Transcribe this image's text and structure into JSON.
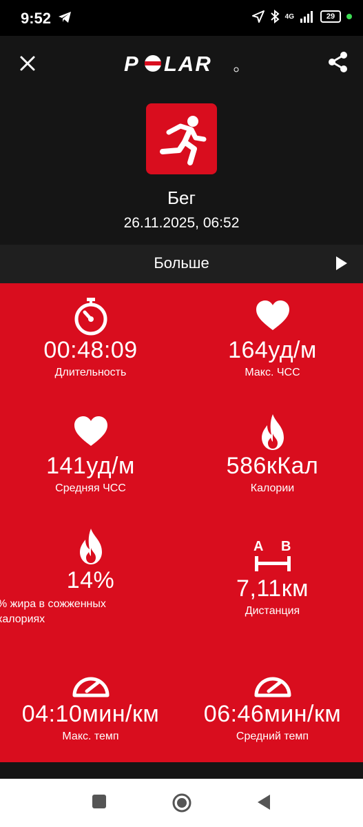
{
  "status_bar": {
    "time": "9:52",
    "battery": "29",
    "network": "4G"
  },
  "app_bar": {
    "brand": "POLAR",
    "close_icon": "close-icon",
    "share_icon": "share-icon"
  },
  "session": {
    "sport": "Бег",
    "datetime": "26.11.2025, 06:52",
    "sport_icon": "running-person-icon"
  },
  "more_row": {
    "label": "Больше"
  },
  "stats": [
    {
      "value": "00:48:09",
      "label": "Длительность",
      "icon": "stopwatch-icon"
    },
    {
      "value": "164уд/м",
      "label": "Макс. ЧСС",
      "icon": "heart-icon"
    },
    {
      "value": "141уд/м",
      "label": "Средняя ЧСС",
      "icon": "heart-icon"
    },
    {
      "value": "586кКал",
      "label": "Калории",
      "icon": "flame-icon"
    },
    {
      "value": "14%",
      "label": "% жира в сожженных калориях",
      "icon": "flame-icon"
    },
    {
      "value": "7,11км",
      "label": "Дистанция",
      "icon": "distance-ab-icon"
    },
    {
      "value": "04:10мин/км",
      "label": "Макс. темп",
      "icon": "speedometer-icon"
    },
    {
      "value": "06:46мин/км",
      "label": "Средний темп",
      "icon": "speedometer-icon"
    }
  ],
  "colors": {
    "polar_red": "#d90d1e",
    "dark_bg": "#151515",
    "more_row_bg": "#1f1f1f"
  }
}
